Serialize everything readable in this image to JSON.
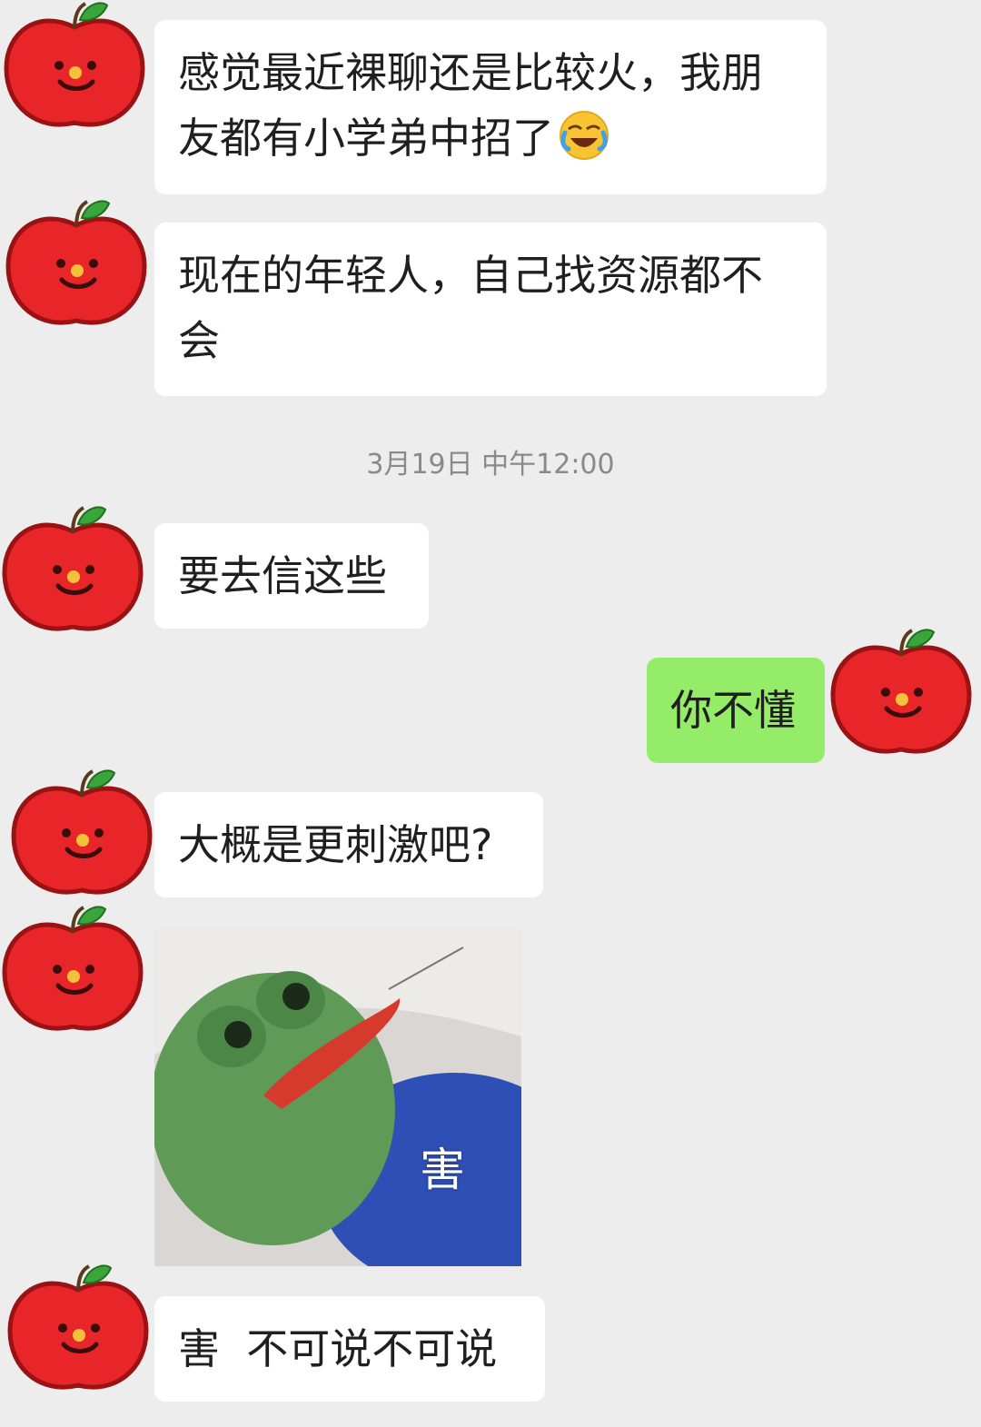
{
  "messages": [
    {
      "text_line1": "感觉最近裸聊还是比较火，我朋",
      "text_line2": "友都有小学弟中招了",
      "emoji": "face-with-tears-of-joy-icon"
    },
    {
      "text_line1": "现在的年轻人，自己找资源都不",
      "text_line2": "会"
    },
    {
      "text": "要去信这些"
    },
    {
      "text": "你不懂"
    },
    {
      "text": "大概是更刺激吧?"
    },
    {
      "sticker_caption": "害"
    },
    {
      "text": "害  不可说不可说"
    }
  ],
  "timestamp": "3月19日 中午12:00",
  "colors": {
    "background": "#ededed",
    "incoming_bubble": "#ffffff",
    "outgoing_bubble": "#95ec69",
    "avatar_red": "#e8262a"
  }
}
